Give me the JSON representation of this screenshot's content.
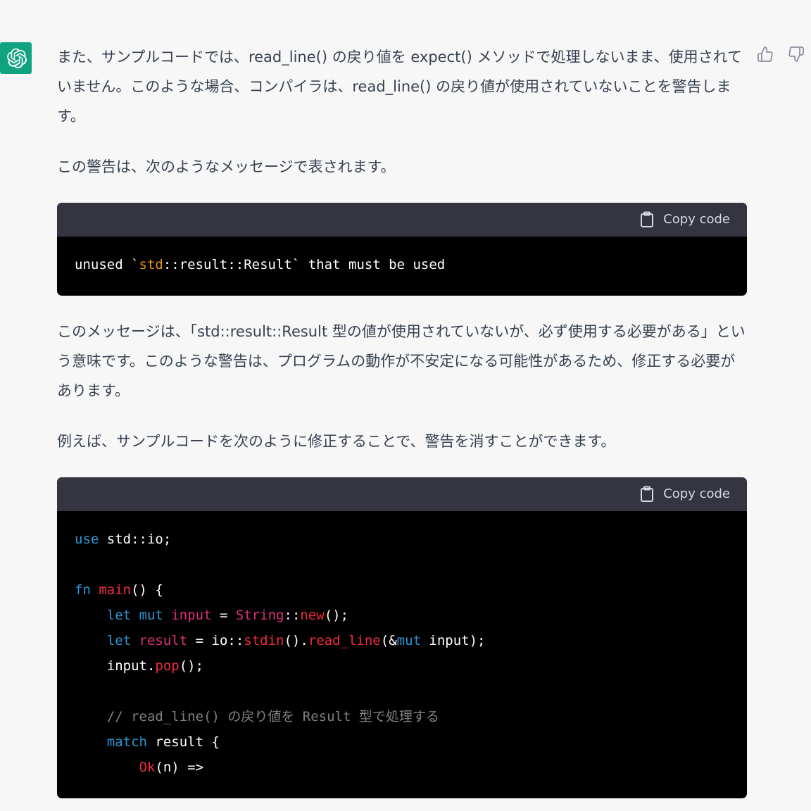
{
  "message": {
    "paragraph1": "また、サンプルコードでは、read_line() の戻り値を expect() メソッドで処理しないまま、使用されていません。このような場合、コンパイラは、read_line() の戻り値が使用されていないことを警告します。",
    "paragraph2": "この警告は、次のようなメッセージで表されます。",
    "paragraph3": "このメッセージは、「std::result::Result 型の値が使用されていないが、必ず使用する必要がある」という意味です。このような警告は、プログラムの動作が不安定になる可能性があるため、修正する必要があります。",
    "paragraph4": "例えば、サンプルコードを次のように修正することで、警告を消すことができます。"
  },
  "code_block_1": {
    "copy_label": "Copy code",
    "line1": {
      "a": "unused `",
      "b": "std",
      "c": "::result::Result` that must be used"
    }
  },
  "code_block_2": {
    "copy_label": "Copy code",
    "l1_kw": "use",
    "l1_rest": " std::io;",
    "l2_kw": "fn",
    "l2_name": "main",
    "l2_rest": "() {",
    "l3_kw1": "let",
    "l3_kw2": "mut",
    "l3_var": "input",
    "l3_eq": " = ",
    "l3_type": "String",
    "l3_sep": "::",
    "l3_fn": "new",
    "l3_end": "();",
    "l4_kw": "let",
    "l4_var": "result",
    "l4_mid": " = io::",
    "l4_fn1": "stdin",
    "l4_mid2": "().",
    "l4_fn2": "read_line",
    "l4_mid3": "(&",
    "l4_kw2": "mut",
    "l4_end": " input);",
    "l5_a": "input.",
    "l5_fn": "pop",
    "l5_end": "();",
    "l6_comment": "// read_line() の戻り値を Result 型で処理する",
    "l7_kw": "match",
    "l7_rest": " result {",
    "l8_type": "Ok",
    "l8_rest": "(n) =>"
  }
}
